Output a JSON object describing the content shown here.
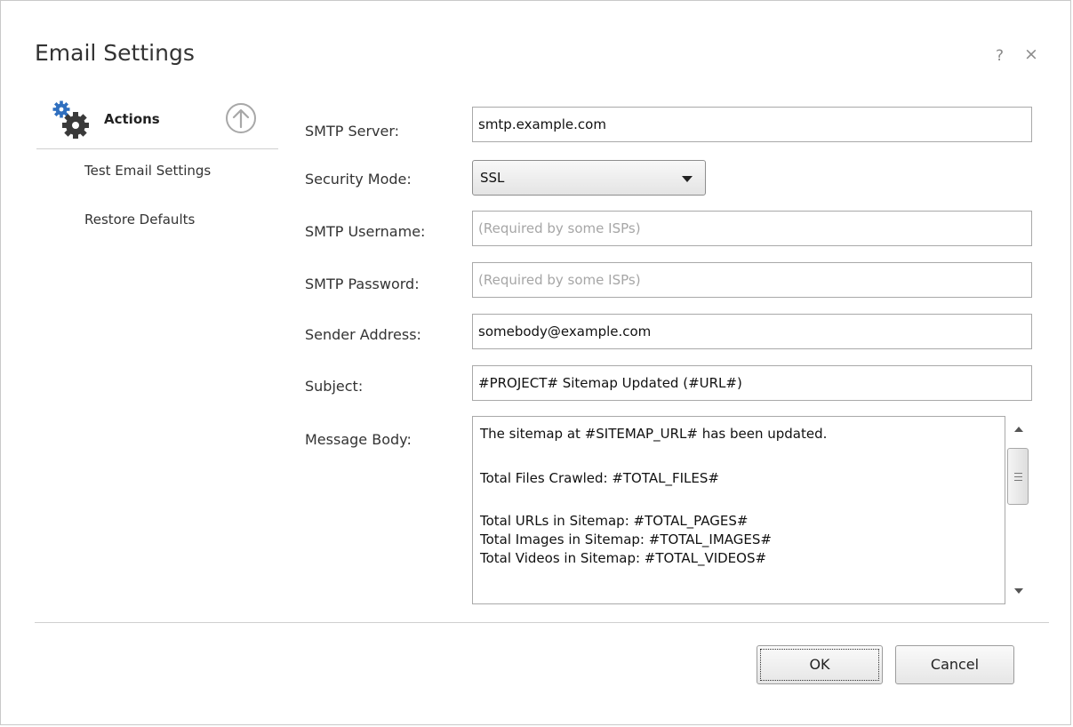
{
  "window": {
    "title": "Email Settings",
    "help_glyph": "?",
    "close_glyph": "×"
  },
  "sidebar": {
    "header_label": "Actions",
    "header_icon": "gears-icon",
    "collapse_icon": "circle-up-arrow-icon",
    "items": [
      {
        "label": "Test Email Settings"
      },
      {
        "label": "Restore Defaults"
      }
    ]
  },
  "form": {
    "smtp_server": {
      "label": "SMTP Server:",
      "value": "smtp.example.com",
      "placeholder": ""
    },
    "security_mode": {
      "label": "Security Mode:",
      "value": "SSL"
    },
    "smtp_username": {
      "label": "SMTP Username:",
      "value": "",
      "placeholder": "(Required by some ISPs)"
    },
    "smtp_password": {
      "label": "SMTP Password:",
      "value": "",
      "placeholder": "(Required by some ISPs)"
    },
    "sender_address": {
      "label": "Sender Address:",
      "value": "somebody@example.com",
      "placeholder": ""
    },
    "subject": {
      "label": "Subject:",
      "value": "#PROJECT# Sitemap Updated (#URL#)",
      "placeholder": ""
    },
    "message_body": {
      "label": "Message Body:",
      "lines": [
        "The sitemap at #SITEMAP_URL# has been updated.",
        "",
        "Total Files Crawled: #TOTAL_FILES#",
        "",
        "Total URLs in Sitemap: #TOTAL_PAGES#",
        "Total Images in Sitemap: #TOTAL_IMAGES#",
        "Total Videos in Sitemap: #TOTAL_VIDEOS#"
      ]
    }
  },
  "buttons": {
    "ok": "OK",
    "cancel": "Cancel"
  },
  "colors": {
    "accent_gear": "#2f6fbf",
    "gear_dark": "#3a3a3a"
  }
}
